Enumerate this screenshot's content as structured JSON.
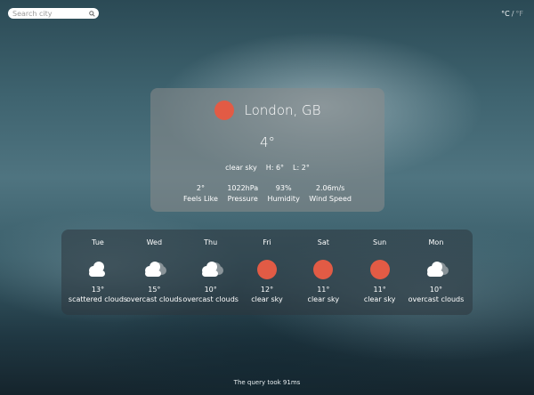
{
  "search": {
    "placeholder": "Search city"
  },
  "units": {
    "celsius": "°C",
    "separator": "/",
    "fahrenheit": "°F"
  },
  "current": {
    "location": "London, GB",
    "temperature": "4°",
    "description": "clear sky",
    "high": "H: 6°",
    "low": "L: 2°",
    "icon": "sun-icon",
    "stats": [
      {
        "value": "2°",
        "label": "Feels Like"
      },
      {
        "value": "1022hPa",
        "label": "Pressure"
      },
      {
        "value": "93%",
        "label": "Humidity"
      },
      {
        "value": "2.06m/s",
        "label": "Wind Speed"
      }
    ]
  },
  "forecast": [
    {
      "day": "Tue",
      "temp": "13°",
      "desc": "scattered clouds",
      "icon": "cloud-icon"
    },
    {
      "day": "Wed",
      "temp": "15°",
      "desc": "overcast clouds",
      "icon": "overcast-cloud-icon"
    },
    {
      "day": "Thu",
      "temp": "10°",
      "desc": "overcast clouds",
      "icon": "overcast-cloud-icon"
    },
    {
      "day": "Fri",
      "temp": "12°",
      "desc": "clear sky",
      "icon": "sun-icon"
    },
    {
      "day": "Sat",
      "temp": "11°",
      "desc": "clear sky",
      "icon": "sun-icon"
    },
    {
      "day": "Sun",
      "temp": "11°",
      "desc": "clear sky",
      "icon": "sun-icon"
    },
    {
      "day": "Mon",
      "temp": "10°",
      "desc": "overcast clouds",
      "icon": "overcast-cloud-icon"
    }
  ],
  "footer": "The query took 91ms",
  "colors": {
    "sun": "#e25b45",
    "panel": "#8c8c8c",
    "forecast_panel": "#2d373e"
  }
}
